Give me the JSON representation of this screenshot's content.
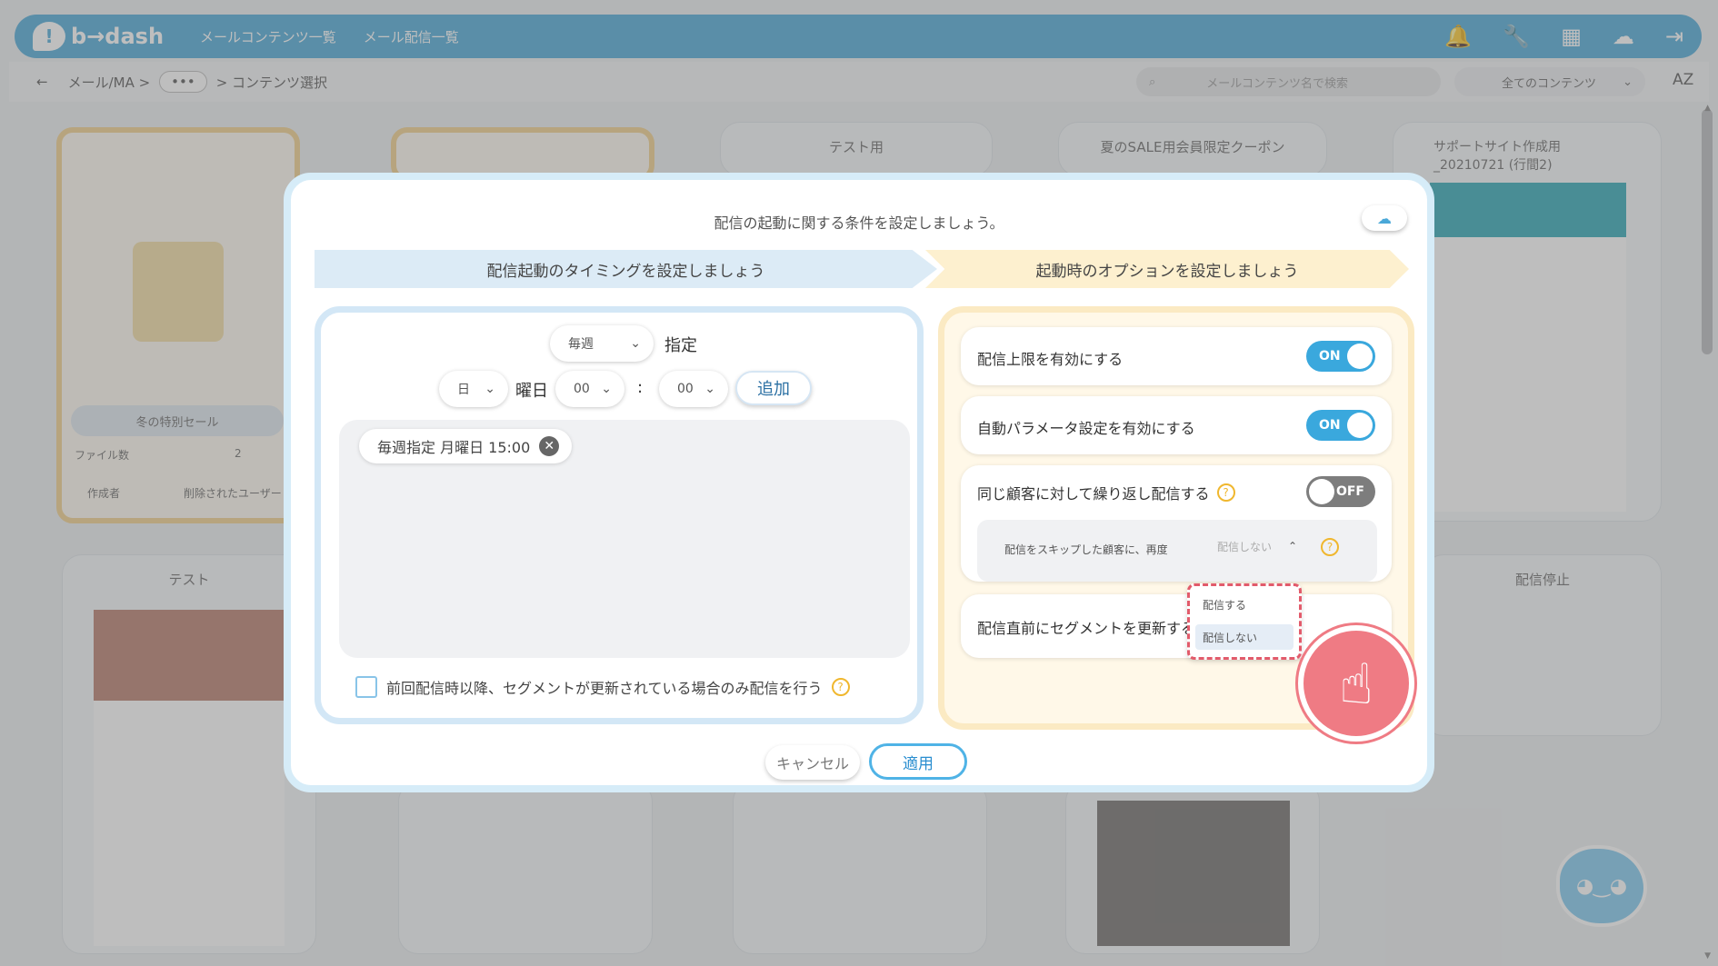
{
  "app": {
    "logo_text": "b→dash",
    "nav": [
      "メールコンテンツ一覧",
      "メール配信一覧"
    ]
  },
  "breadcrumb": {
    "back": "←",
    "root": "メール/MA >",
    "more": "•••",
    "current": "> コンテンツ選択"
  },
  "search": {
    "placeholder": "メールコンテンツ名で検索"
  },
  "filter": {
    "selected": "全てのコンテンツ"
  },
  "sort_label": "AZ",
  "background_cards": [
    "冬の特別セール",
    "テスト用",
    "夏のSALE用会員限定クーポン",
    "サポートサイト作成用_20210721 (行間2)",
    "テスト",
    "配信停止"
  ],
  "folder_meta": {
    "files_label": "ファイル数",
    "files_count": "2",
    "author_label": "作成者",
    "author_value": "削除されたユーザー"
  },
  "modal": {
    "title": "配信の起動に関する条件を設定しましょう。",
    "step1": "配信起動のタイミングを設定しましょう",
    "step2": "起動時のオプションを設定しましょう",
    "timing": {
      "freq_value": "毎週",
      "freq_suffix": "指定",
      "day_value": "日",
      "day_suffix": "曜日",
      "hour_value": "00",
      "colon": ":",
      "minute_value": "00",
      "add_button": "追加",
      "schedule_chip": "毎週指定 月曜日 15:00",
      "segment_checkbox_label": "前回配信時以降、セグメントが更新されている場合のみ配信を行う"
    },
    "options": [
      {
        "label": "配信上限を有効にする",
        "toggle": "ON"
      },
      {
        "label": "自動パラメータ設定を有効にする",
        "toggle": "ON"
      },
      {
        "label": "同じ顧客に対して繰り返し配信する",
        "toggle": "OFF"
      },
      {
        "label": "配信直前にセグメントを更新する"
      }
    ],
    "skip_row": {
      "label": "配信をスキップした顧客に、再度",
      "selected": "配信しない",
      "dropdown_options": [
        "配信する",
        "配信しない"
      ]
    },
    "cancel_button": "キャンセル",
    "apply_button": "適用"
  },
  "help_mark": "?",
  "colors": {
    "header": "#4aa8d8",
    "toggle_on": "#3aa8dd",
    "toggle_off": "#7d7d7d",
    "highlight": "#e25b6b",
    "step1_bg": "#dcebf6",
    "step2_bg": "#fdf0cf"
  },
  "icons": [
    "bell-icon",
    "wrench-icon",
    "grid-icon",
    "cloud-help-icon",
    "logout-icon",
    "search-icon",
    "pointing-hand-icon",
    "mascot-icon"
  ]
}
